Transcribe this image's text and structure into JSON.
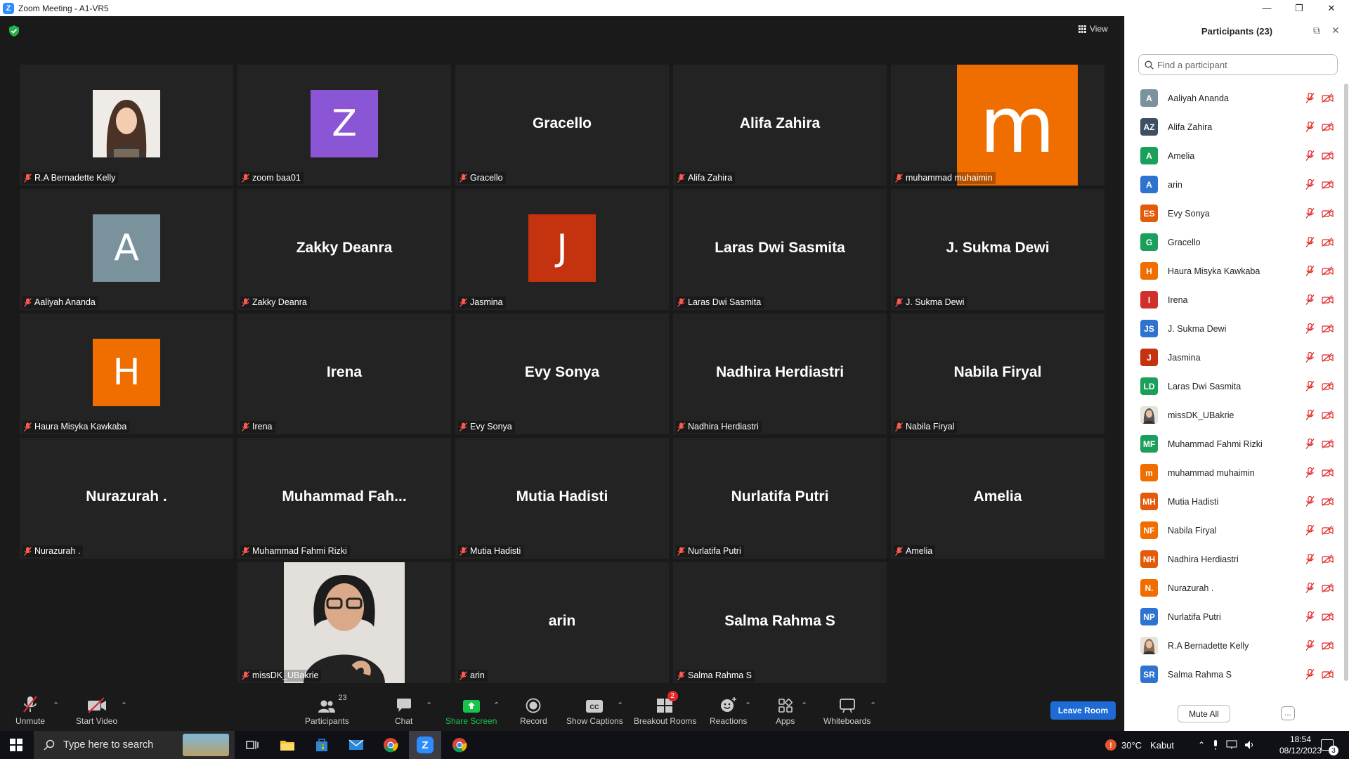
{
  "window": {
    "title": "Zoom Meeting - A1-VR5"
  },
  "gallery": {
    "view_label": "View",
    "tiles": [
      {
        "tag": "R.A Bernadette Kelly",
        "big": "",
        "kind": "photo-woman"
      },
      {
        "tag": "zoom baa01",
        "big": "Z",
        "kind": "avatar",
        "color": "#8a56d6"
      },
      {
        "tag": "Gracello",
        "big": "Gracello",
        "kind": "name"
      },
      {
        "tag": "Alifa Zahira",
        "big": "Alifa Zahira",
        "kind": "name"
      },
      {
        "tag": "muhammad muhaimin",
        "big": "m",
        "kind": "big-m",
        "color": "#f06d00"
      },
      {
        "tag": "Aaliyah Ananda",
        "big": "A",
        "kind": "avatar",
        "color": "#7a929c"
      },
      {
        "tag": "Zakky Deanra",
        "big": "Zakky Deanra",
        "kind": "name"
      },
      {
        "tag": "Jasmina",
        "big": "J",
        "kind": "avatar",
        "color": "#c4320f"
      },
      {
        "tag": "Laras Dwi Sasmita",
        "big": "Laras Dwi Sasmita",
        "kind": "name"
      },
      {
        "tag": "J. Sukma Dewi",
        "big": "J. Sukma Dewi",
        "kind": "name"
      },
      {
        "tag": "Haura Misyka Kawkaba",
        "big": "H",
        "kind": "avatar",
        "color": "#f06d00"
      },
      {
        "tag": "Irena",
        "big": "Irena",
        "kind": "name"
      },
      {
        "tag": "Evy Sonya",
        "big": "Evy Sonya",
        "kind": "name"
      },
      {
        "tag": "Nadhira Herdiastri",
        "big": "Nadhira Herdiastri",
        "kind": "name"
      },
      {
        "tag": "Nabila Firyal",
        "big": "Nabila Firyal",
        "kind": "name"
      },
      {
        "tag": "Nurazurah .",
        "big": "Nurazurah .",
        "kind": "name"
      },
      {
        "tag": "Muhammad Fahmi Rizki",
        "big": "Muhammad  Fah...",
        "kind": "name"
      },
      {
        "tag": "Mutia Hadisti",
        "big": "Mutia Hadisti",
        "kind": "name"
      },
      {
        "tag": "Nurlatifa Putri",
        "big": "Nurlatifa Putri",
        "kind": "name"
      },
      {
        "tag": "Amelia",
        "big": "Amelia",
        "kind": "name"
      },
      {
        "tag": "missDK_UBakrie",
        "big": "",
        "kind": "photo-speaker"
      },
      {
        "tag": "arin",
        "big": "arin",
        "kind": "name"
      },
      {
        "tag": "Salma Rahma S",
        "big": "Salma Rahma S",
        "kind": "name"
      }
    ]
  },
  "toolbar": {
    "unmute": "Unmute",
    "start_video": "Start Video",
    "participants": "Participants",
    "participants_count": "23",
    "chat": "Chat",
    "share_screen": "Share Screen",
    "record": "Record",
    "show_captions": "Show Captions",
    "breakout_rooms": "Breakout Rooms",
    "breakout_badge": "2",
    "reactions": "Reactions",
    "apps": "Apps",
    "whiteboards": "Whiteboards",
    "leave_room": "Leave Room",
    "share_color": "#19c34a",
    "leave_color": "#1e6bd6"
  },
  "panel": {
    "title": "Participants (23)",
    "search_placeholder": "Find a participant",
    "mute_all": "Mute All",
    "more": "...",
    "participants": [
      {
        "initials": "A",
        "name": "Aaliyah Ananda",
        "color": "#7a929c"
      },
      {
        "initials": "AZ",
        "name": "Alifa Zahira",
        "color": "#3d4f63"
      },
      {
        "initials": "A",
        "name": "Amelia",
        "color": "#1aa05a"
      },
      {
        "initials": "A",
        "name": "arin",
        "color": "#2f73d0"
      },
      {
        "initials": "ES",
        "name": "Evy Sonya",
        "color": "#e35b0a"
      },
      {
        "initials": "G",
        "name": "Gracello",
        "color": "#1aa05a"
      },
      {
        "initials": "H",
        "name": "Haura Misyka Kawkaba",
        "color": "#f06d00"
      },
      {
        "initials": "I",
        "name": "Irena",
        "color": "#d0302a"
      },
      {
        "initials": "JS",
        "name": "J. Sukma Dewi",
        "color": "#2f73d0"
      },
      {
        "initials": "J",
        "name": "Jasmina",
        "color": "#c4320f"
      },
      {
        "initials": "LD",
        "name": "Laras Dwi Sasmita",
        "color": "#1aa05a"
      },
      {
        "initials": "",
        "name": "missDK_UBakrie",
        "color": "#555555",
        "photo": true
      },
      {
        "initials": "MF",
        "name": "Muhammad Fahmi Rizki",
        "color": "#1aa05a"
      },
      {
        "initials": "m",
        "name": "muhammad muhaimin",
        "color": "#f06d00"
      },
      {
        "initials": "MH",
        "name": "Mutia Hadisti",
        "color": "#e35b0a"
      },
      {
        "initials": "NF",
        "name": "Nabila Firyal",
        "color": "#f06d00"
      },
      {
        "initials": "NH",
        "name": "Nadhira Herdiastri",
        "color": "#e35b0a"
      },
      {
        "initials": "N.",
        "name": "Nurazurah .",
        "color": "#f06d00"
      },
      {
        "initials": "NP",
        "name": "Nurlatifa Putri",
        "color": "#2f73d0"
      },
      {
        "initials": "",
        "name": "R.A Bernadette Kelly",
        "color": "#8a6a50",
        "photo": true
      },
      {
        "initials": "SR",
        "name": "Salma Rahma S",
        "color": "#2f73d0"
      }
    ]
  },
  "taskbar": {
    "search_placeholder": "Type here to search",
    "weather_temp": "30°C",
    "weather_text": "Kabut",
    "time": "18:54",
    "date": "08/12/2023",
    "notification_count": "3"
  }
}
